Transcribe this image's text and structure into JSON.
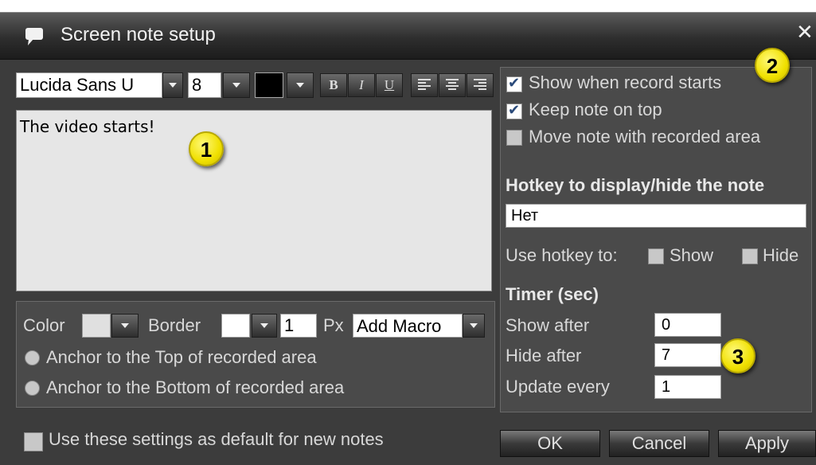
{
  "window": {
    "title": "Screen note setup",
    "close_glyph": "✕"
  },
  "toolbar": {
    "font_name": "Lucida Sans U",
    "font_size": "8",
    "bold": "B",
    "italic": "I",
    "underline": "U",
    "text_color": "#000000"
  },
  "note_text": "The video starts!",
  "appearance": {
    "color_label": "Color",
    "border_label": "Border",
    "border_width": "1",
    "px_label": "Px",
    "macro_label": "Add Macro",
    "anchor_top": "Anchor to the Top of recorded area",
    "anchor_bottom": "Anchor to the Bottom of recorded area"
  },
  "options": {
    "show_when_record_starts": {
      "label": "Show when record starts",
      "checked": true
    },
    "keep_note_on_top": {
      "label": "Keep note on top",
      "checked": true
    },
    "move_note_with_area": {
      "label": "Move note with recorded area",
      "checked": false
    }
  },
  "hotkey": {
    "heading": "Hotkey to display/hide the note",
    "value": "Нет",
    "use_label": "Use hotkey to:",
    "show_label": "Show",
    "hide_label": "Hide"
  },
  "timer": {
    "heading": "Timer (sec)",
    "show_after_label": "Show after",
    "show_after_value": "0",
    "hide_after_label": "Hide after",
    "hide_after_value": "7",
    "update_every_label": "Update every",
    "update_every_value": "1"
  },
  "footer": {
    "default_label": "Use these settings as default for new notes",
    "ok": "OK",
    "cancel": "Cancel",
    "apply": "Apply"
  },
  "callouts": [
    "1",
    "2",
    "3"
  ],
  "colors": {
    "badge": "#f0e000",
    "panel": "#4a4a4a",
    "window": "#3c3c3c"
  }
}
